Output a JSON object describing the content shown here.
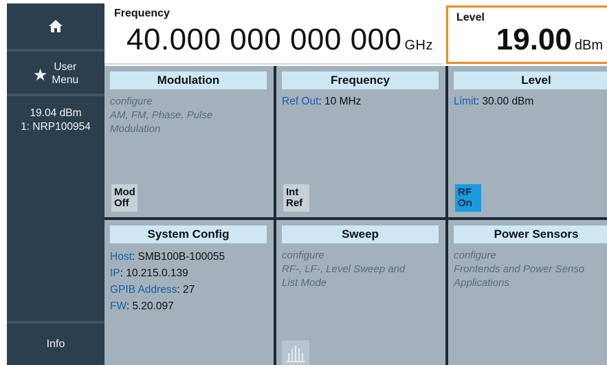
{
  "sidebar": {
    "home_icon": "home-icon",
    "user_menu": {
      "icon": "star-icon",
      "line1": "User",
      "line2": "Menu"
    },
    "sensor": {
      "line1": "19.04 dBm",
      "line2": "1: NRP100954"
    },
    "info_label": "Info"
  },
  "header": {
    "frequency": {
      "label": "Frequency",
      "value": "40.000 000 000 000",
      "unit": "GHz"
    },
    "level": {
      "label": "Level",
      "value": "19.00",
      "unit": "dBm"
    }
  },
  "tiles": {
    "modulation": {
      "title": "Modulation",
      "desc_line1": "configure",
      "desc_line2": "AM, FM, Phase, Pulse",
      "desc_line3": "Modulation",
      "button_line1": "Mod",
      "button_line2": "Off"
    },
    "frequency": {
      "title": "Frequency",
      "ref_key": "Ref Out",
      "ref_value": ": 10 MHz",
      "button_line1": "Int",
      "button_line2": "Ref"
    },
    "level": {
      "title": "Level",
      "limit_key": "Limit",
      "limit_value": ": 30.00 dBm",
      "button_line1": "RF",
      "button_line2": "On"
    },
    "system_config": {
      "title": "System Config",
      "host_key": "Host",
      "host_value": ": SMB100B-100055",
      "ip_key": "IP",
      "ip_value": ": 10.215.0.139",
      "gpib_key": "GPIB Address",
      "gpib_value": ": 27",
      "fw_key": "FW",
      "fw_value": ": 5.20.097"
    },
    "sweep": {
      "title": "Sweep",
      "desc_line1": "configure",
      "desc_line2": "RF-, LF-, Level Sweep and",
      "desc_line3": "List Mode",
      "icon": "sweep-icon"
    },
    "power_sensors": {
      "title": "Power Sensors",
      "desc_line1": "configure",
      "desc_line2": "Frontends and Power Senso",
      "desc_line3": "Applications"
    }
  },
  "colors": {
    "sidebar_bg": "#2c3f4f",
    "tile_bg": "#a3b1bd",
    "tile_title_bg": "#cde7f5",
    "accent_orange": "#f08a24",
    "rf_on_blue": "#1a9be0",
    "key_blue": "#1a5fa8"
  }
}
